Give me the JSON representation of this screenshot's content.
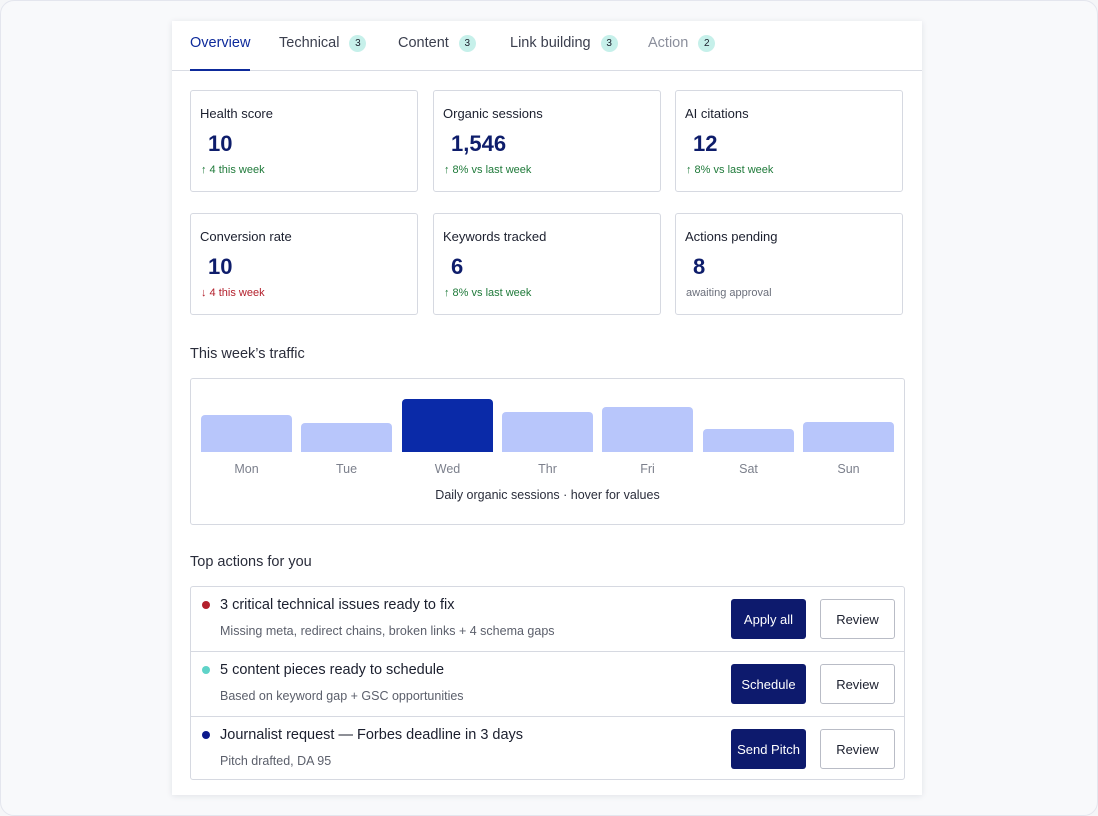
{
  "tabs": [
    {
      "label": "Overview",
      "badge": ""
    },
    {
      "label": "Technical",
      "badge": "3"
    },
    {
      "label": "Content",
      "badge": "3"
    },
    {
      "label": "Link building",
      "badge": "3"
    },
    {
      "label": "Action",
      "badge": "2"
    }
  ],
  "stats": [
    {
      "label": "Health score",
      "value": "10",
      "delta": "↑ 4 this week",
      "trend": "up"
    },
    {
      "label": "Organic sessions",
      "value": "1,546",
      "delta": "↑ 8% vs last week",
      "trend": "up"
    },
    {
      "label": "AI citations",
      "value": "12",
      "delta": "↑ 8% vs last week",
      "trend": "up"
    },
    {
      "label": "Conversion rate",
      "value": "10",
      "delta": "↓ 4 this week",
      "trend": "down"
    },
    {
      "label": "Keywords tracked",
      "value": "6",
      "delta": "↑ 8% vs last week",
      "trend": "up"
    },
    {
      "label": "Actions pending",
      "value": "8",
      "delta": "awaiting approval",
      "trend": "neutral"
    }
  ],
  "traffic": {
    "title": "This week’s traffic",
    "caption": "Daily organic sessions · hover for values"
  },
  "chart_data": {
    "type": "bar",
    "categories": [
      "Mon",
      "Tue",
      "Wed",
      "Thr",
      "Fri",
      "Sat",
      "Sun"
    ],
    "values": [
      37,
      29,
      53,
      40,
      45,
      23,
      30
    ],
    "highlight_index": 2,
    "colors": {
      "bar": "#b8c6fb",
      "highlight": "#0a2aa8"
    }
  },
  "actions_section": {
    "title": "Top actions for you",
    "items": [
      {
        "title": "3 critical technical issues ready to fix",
        "subtitle": "Missing meta, redirect chains, broken links + 4 schema gaps",
        "dot_color": "#b3202c",
        "primary": "Apply all",
        "secondary": "Review"
      },
      {
        "title": "5 content pieces ready to schedule",
        "subtitle": "Based on keyword gap + GSC opportunities",
        "dot_color": "#5fd3c8",
        "primary": "Schedule",
        "secondary": "Review"
      },
      {
        "title": "Journalist request — Forbes deadline in 3 days",
        "subtitle": "Pitch drafted, DA 95",
        "dot_color": "#0d1a8c",
        "primary": "Send Pitch",
        "secondary": "Review"
      }
    ]
  }
}
